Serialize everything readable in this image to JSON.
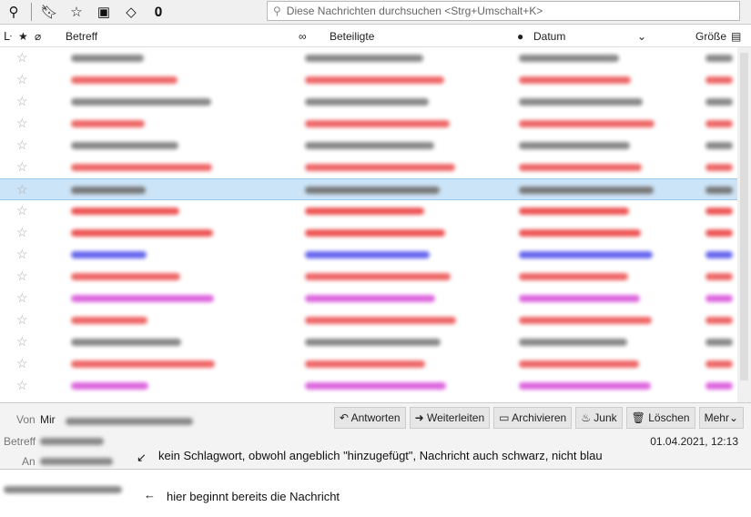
{
  "toolbar": {
    "icons": [
      "quick-filter-pin-icon",
      "unread-icon",
      "starred-icon",
      "contact-icon",
      "tag-icon",
      "attachment-icon"
    ],
    "search_placeholder": "Diese Nachrichten durchsuchen <Strg+Umschalt+K>"
  },
  "columns": {
    "subject": "Betreff",
    "participants": "Beteiligte",
    "date": "Datum",
    "size": "Größe"
  },
  "rows": [
    "#888888",
    "#ee6666",
    "#888888",
    "#ee6666",
    "#888888",
    "#ee6666",
    "#777777",
    "#ee5555",
    "#ee5555",
    "#6666ee",
    "#ee6666",
    "#dd66dd",
    "#ee6666",
    "#888888",
    "#ee6666",
    "#dd66dd"
  ],
  "selected_row": 6,
  "message": {
    "from_label": "Von",
    "from_value": "Mir",
    "subject_label": "Betreff",
    "to_label": "An",
    "date": "01.04.2021, 12:13"
  },
  "actions": [
    "Antworten",
    "Weiterleiten",
    "Archivieren",
    "Junk",
    "Löschen",
    "Mehr"
  ],
  "annotations": {
    "tag_note": "kein Schlagwort, obwohl angeblich \"hinzugefügt\", Nachricht auch schwarz, nicht blau",
    "body_note": "hier beginnt bereits die Nachricht"
  }
}
